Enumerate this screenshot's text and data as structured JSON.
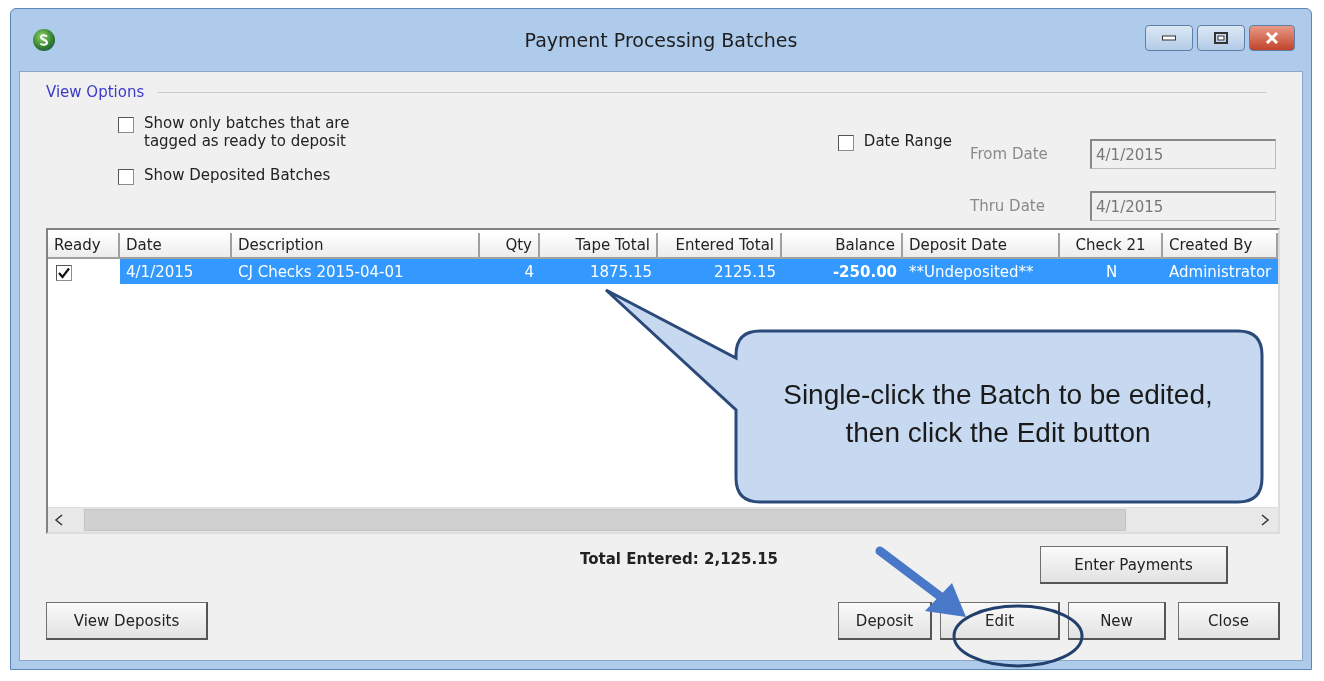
{
  "window": {
    "title": "Payment Processing Batches"
  },
  "view_options": {
    "label": "View Options",
    "checkboxes": [
      {
        "label": "Show only batches that are\ntagged as ready to deposit",
        "checked": false
      },
      {
        "label": "Show Deposited Batches",
        "checked": false
      }
    ],
    "date_range": {
      "label": "Date Range",
      "checked": false,
      "fields": [
        {
          "label": "From Date",
          "value": "4/1/2015",
          "disabled": true
        },
        {
          "label": "Thru Date",
          "value": "4/1/2015",
          "disabled": true
        }
      ]
    }
  },
  "table": {
    "columns": [
      "Ready",
      "Date",
      "Description",
      "Qty",
      "Tape Total",
      "Entered Total",
      "Balance",
      "Deposit Date",
      "Check 21",
      "Created By"
    ],
    "rows": [
      {
        "ready": true,
        "selected": true,
        "cells": [
          "",
          "4/1/2015",
          "CJ Checks 2015-04-01",
          "4",
          "1875.15",
          "2125.15",
          "-250.00",
          "**Undeposited**",
          "N",
          "Administrator"
        ]
      }
    ]
  },
  "total": "Total Entered: 2,125.15",
  "buttons": {
    "enter_payments": "Enter Payments",
    "view_deposits": "View Deposits",
    "actions": [
      "Deposit",
      "Edit",
      "New",
      "Close"
    ]
  },
  "callout": {
    "text": "Single-click the Batch to be edited, then click the Edit button"
  }
}
